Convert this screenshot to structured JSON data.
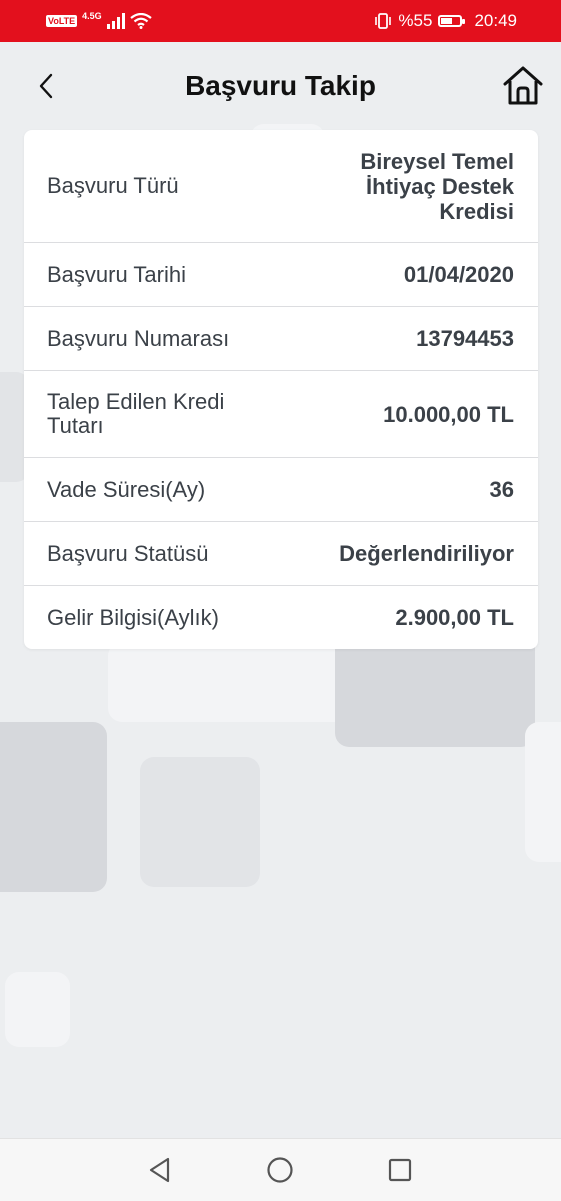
{
  "status_bar": {
    "volte": "VoLTE",
    "network": "4.5G",
    "battery_text": "%55",
    "battery_level": 0.55,
    "time": "20:49"
  },
  "header": {
    "title": "Başvuru Takip",
    "back_icon": "chevron-left-icon",
    "home_icon": "home-icon"
  },
  "details": [
    {
      "label": "Başvuru Türü",
      "value": "Bireysel Temel İhtiyaç Destek Kredisi"
    },
    {
      "label": "Başvuru Tarihi",
      "value": "01/04/2020"
    },
    {
      "label": "Başvuru Numarası",
      "value": "13794453"
    },
    {
      "label": "Talep Edilen Kredi Tutarı",
      "value": "10.000,00 TL"
    },
    {
      "label": "Vade Süresi(Ay)",
      "value": "36"
    },
    {
      "label": "Başvuru Statüsü",
      "value": "Değerlendiriliyor"
    },
    {
      "label": "Gelir Bilgisi(Aylık)",
      "value": "2.900,00 TL"
    }
  ],
  "nav_bar": {
    "icons": [
      "back-triangle-icon",
      "home-circle-icon",
      "recents-square-icon"
    ]
  },
  "colors": {
    "accent": "#e3101d",
    "text": "#3b4148"
  }
}
